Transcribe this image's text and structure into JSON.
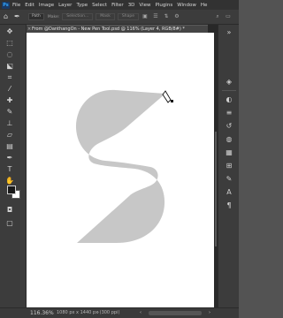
{
  "menubar": {
    "logo": "Ps",
    "items": [
      "File",
      "Edit",
      "Image",
      "Layer",
      "Type",
      "Select",
      "Filter",
      "3D",
      "View",
      "Plugins",
      "Window",
      "He"
    ]
  },
  "options": {
    "mode": "Path",
    "make_label": "Make:",
    "selection": "Selection...",
    "mask": "Mask",
    "shape": "Shape"
  },
  "tab": {
    "close": "×",
    "title": "From @DanthangOn - New Pen Tool.psd @ 116% (Layer 4, RGB/8#) *"
  },
  "status": {
    "zoom": "116.36%",
    "info": "1080 px x 1440 px (300 ppi)",
    "arrow": "›"
  },
  "colors": {
    "shape_fill": "#c7c7c7",
    "foreground": "#1a1a1a",
    "background": "#ffffff"
  }
}
